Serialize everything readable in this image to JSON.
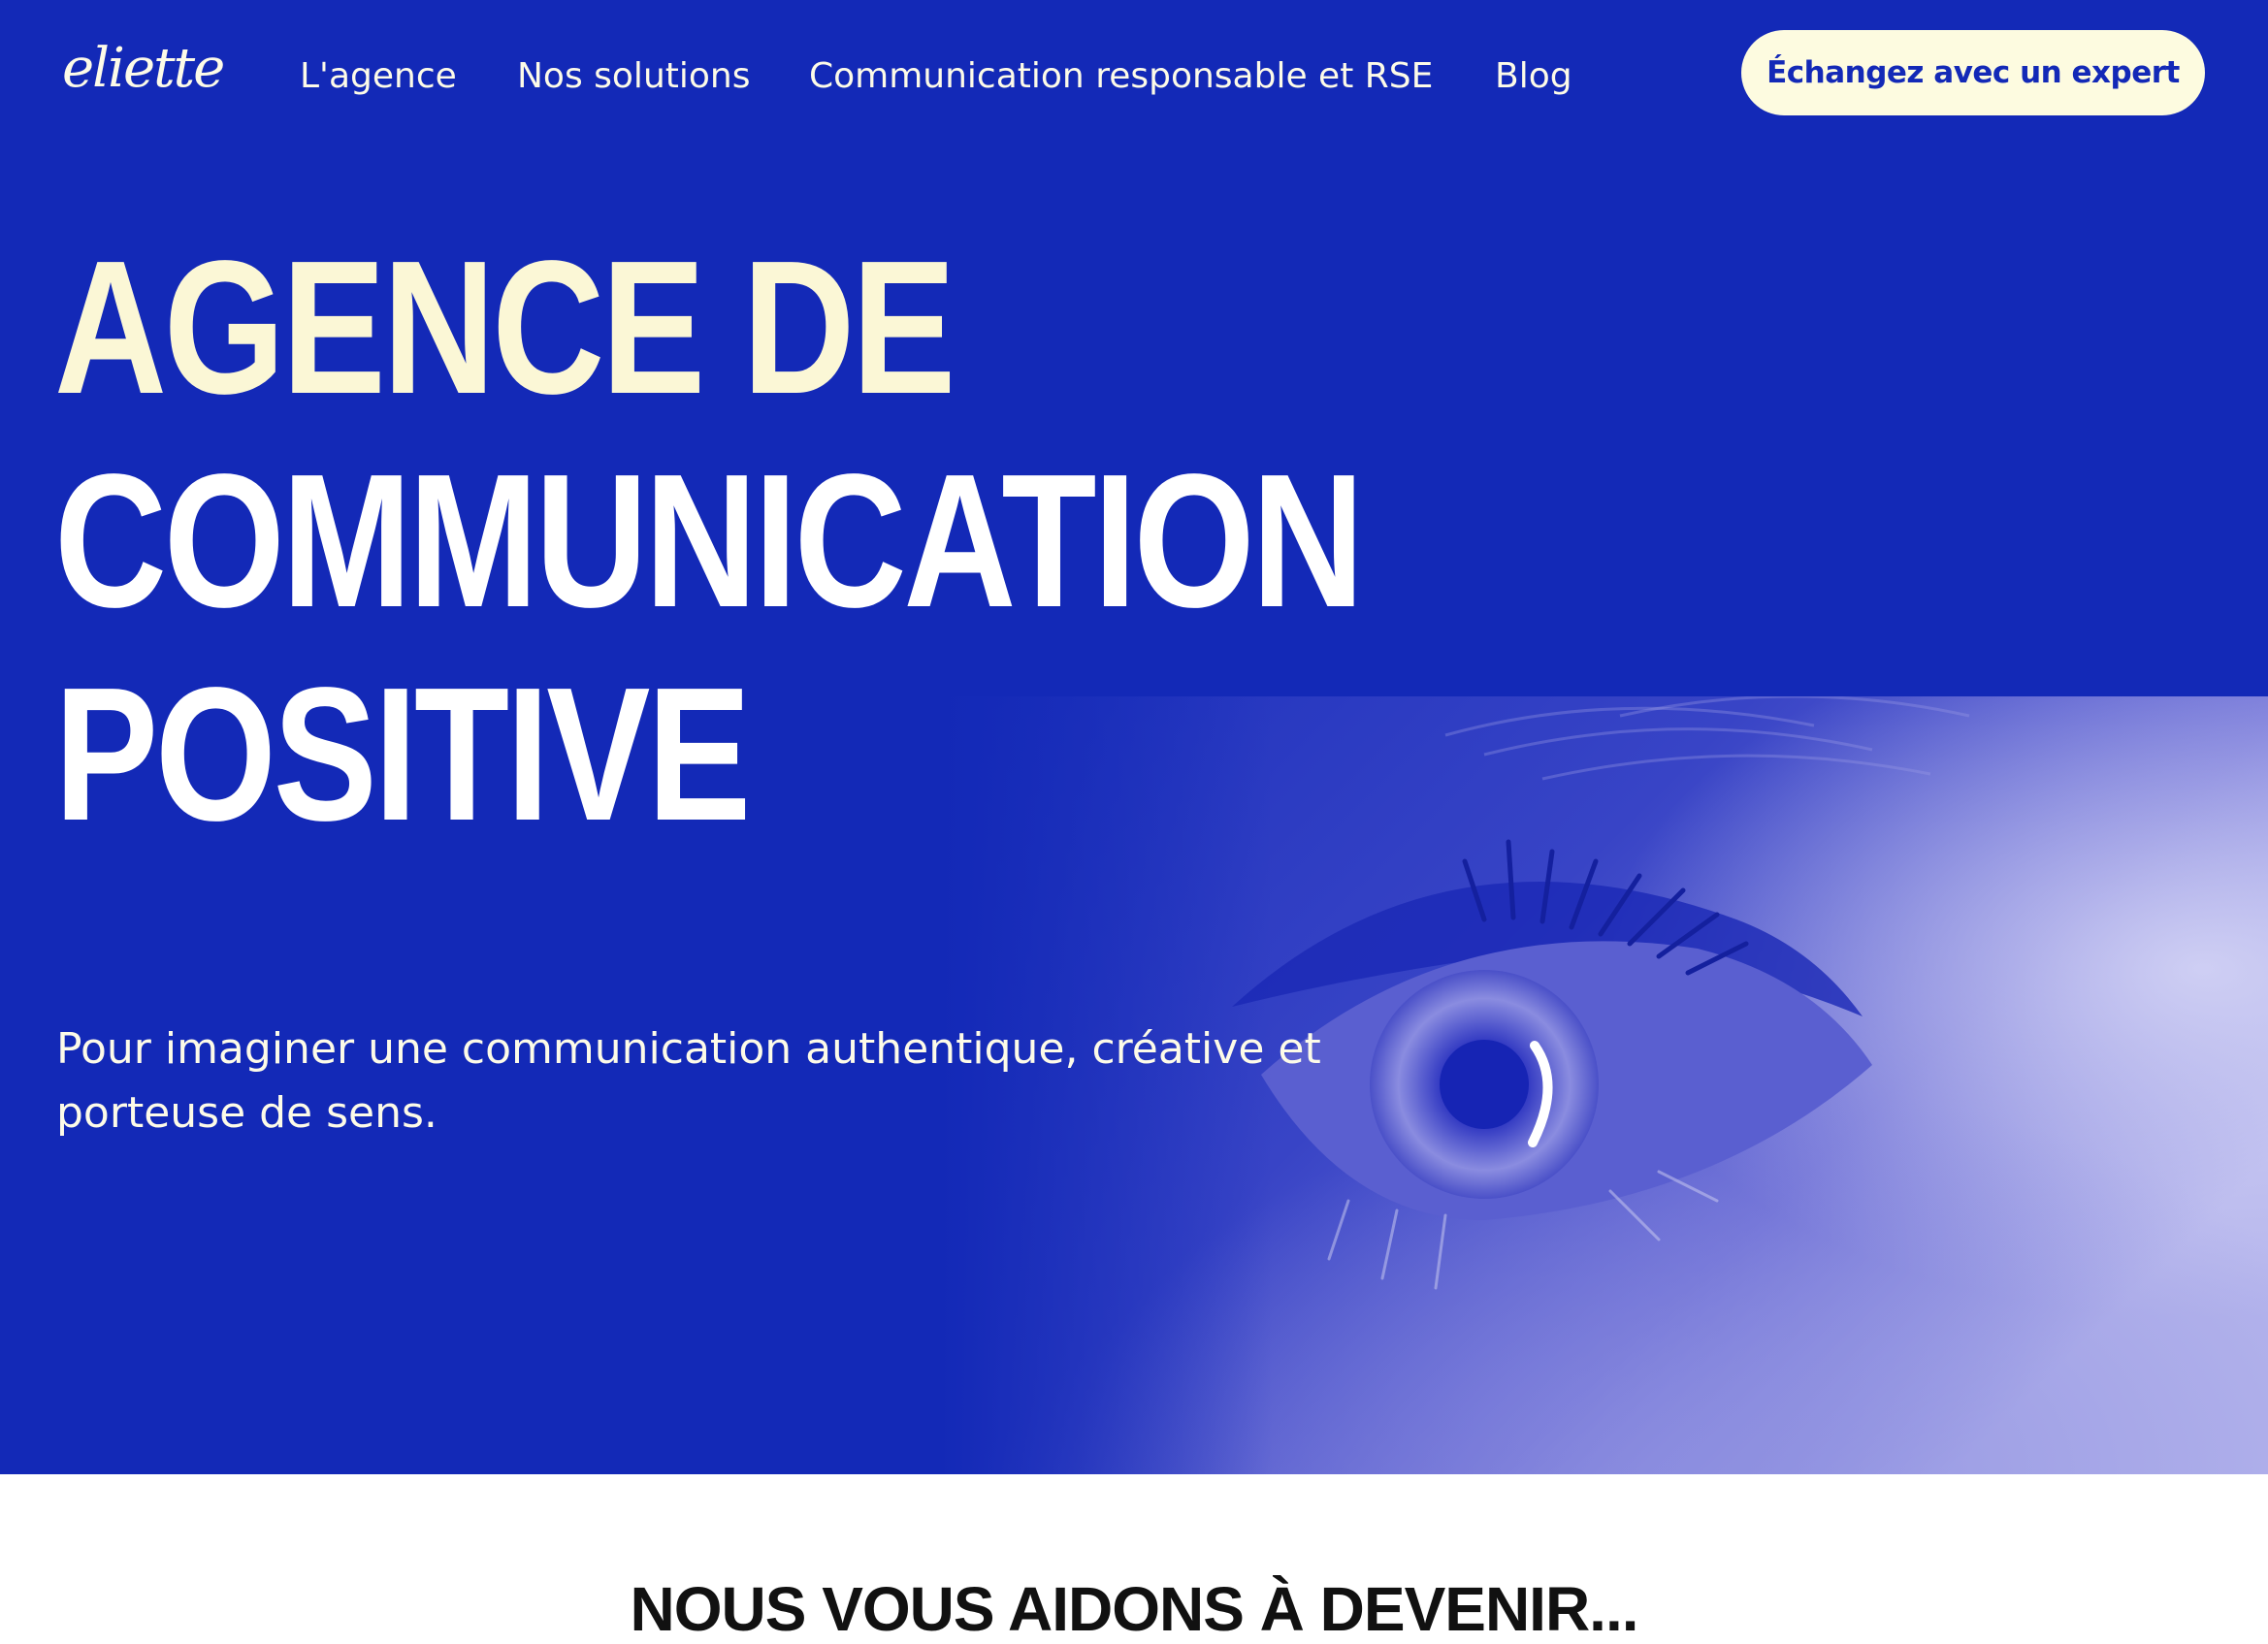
{
  "header": {
    "logo": "eliette",
    "nav": [
      {
        "label": "L'agence"
      },
      {
        "label": "Nos solutions"
      },
      {
        "label": "Communication responsable et RSE"
      },
      {
        "label": "Blog"
      }
    ],
    "cta_label": "Échangez avec un expert"
  },
  "hero": {
    "headline_lines": [
      "AGENCE DE",
      "COMMUNICATION",
      "POSITIVE"
    ],
    "subtitle_lines": [
      "Pour imaginer une communication authentique, créative et",
      "porteuse de sens."
    ],
    "image_icon": "eye-photo"
  },
  "next_section": {
    "title": "NOUS VOUS AIDONS À DEVENIR..."
  },
  "colors": {
    "brand_blue": "#1329b7",
    "cream": "#fbf7d6",
    "white": "#ffffff",
    "dark_text": "#111111"
  }
}
